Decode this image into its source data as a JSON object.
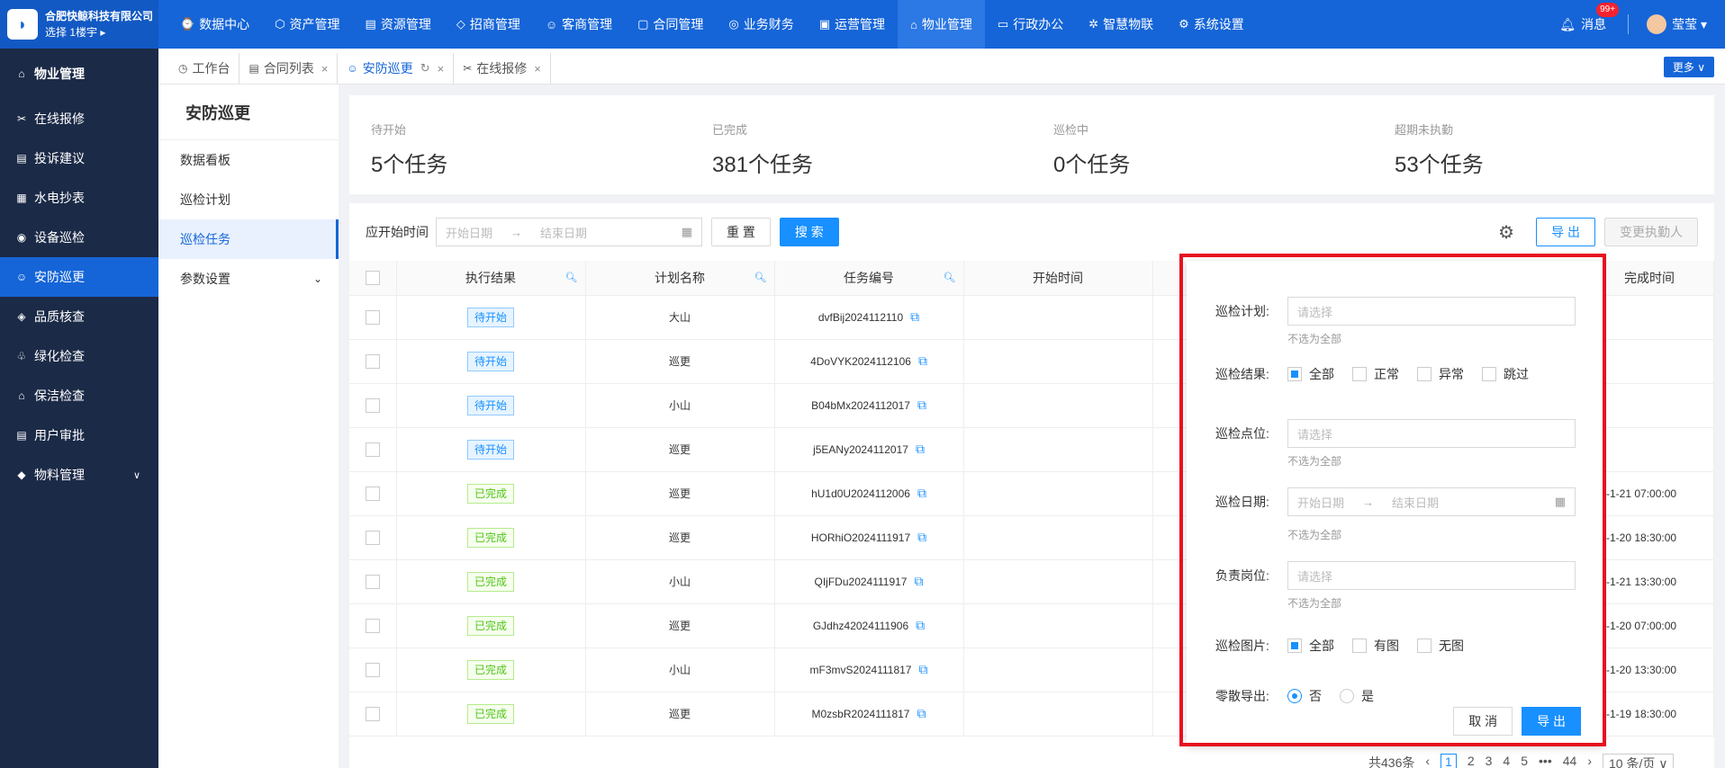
{
  "brand": {
    "name": "合肥快鲸科技有限公司",
    "sub": "选择 1楼宇 ▸"
  },
  "nav": [
    {
      "label": "数据中心",
      "icon": "⌚"
    },
    {
      "label": "资产管理",
      "icon": "⬡"
    },
    {
      "label": "资源管理",
      "icon": "▤"
    },
    {
      "label": "招商管理",
      "icon": "◇"
    },
    {
      "label": "客商管理",
      "icon": "☺"
    },
    {
      "label": "合同管理",
      "icon": "▢"
    },
    {
      "label": "业务财务",
      "icon": "◎"
    },
    {
      "label": "运营管理",
      "icon": "▣"
    },
    {
      "label": "物业管理",
      "icon": "⌂"
    },
    {
      "label": "行政办公",
      "icon": "▭"
    },
    {
      "label": "智慧物联",
      "icon": "✲"
    },
    {
      "label": "系统设置",
      "icon": "⚙"
    }
  ],
  "top_right": {
    "msg_label": "消息",
    "msg_badge": "99+",
    "user": "莹莹 ▾"
  },
  "sidebar": {
    "head": "物业管理",
    "items": [
      {
        "label": "在线报修",
        "icon": "✂"
      },
      {
        "label": "投诉建议",
        "icon": "▤"
      },
      {
        "label": "水电抄表",
        "icon": "▦"
      },
      {
        "label": "设备巡检",
        "icon": "◉"
      },
      {
        "label": "安防巡更",
        "icon": "☺"
      },
      {
        "label": "品质核查",
        "icon": "◈"
      },
      {
        "label": "绿化检查",
        "icon": "♧"
      },
      {
        "label": "保洁检查",
        "icon": "⌂"
      },
      {
        "label": "用户审批",
        "icon": "▤"
      },
      {
        "label": "物料管理",
        "icon": "◆"
      }
    ]
  },
  "tabs": [
    {
      "label": "工作台",
      "icon": "◷"
    },
    {
      "label": "合同列表",
      "icon": "▤"
    },
    {
      "label": "安防巡更",
      "icon": "☺"
    },
    {
      "label": "在线报修",
      "icon": "✂"
    }
  ],
  "more_label": "更多 ∨",
  "submenu": {
    "title": "安防巡更",
    "items": [
      "数据看板",
      "巡检计划",
      "巡检任务",
      "参数设置"
    ]
  },
  "stats": [
    {
      "label": "待开始",
      "value": "5个任务"
    },
    {
      "label": "已完成",
      "value": "381个任务"
    },
    {
      "label": "巡检中",
      "value": "0个任务"
    },
    {
      "label": "超期未执勤",
      "value": "53个任务"
    }
  ],
  "filter": {
    "label": "应开始时间",
    "start_ph": "开始日期",
    "end_ph": "结束日期",
    "reset": "重 置",
    "search": "搜 索",
    "export": "导 出",
    "change": "变更执勤人"
  },
  "table": {
    "headers": [
      "执行结果",
      "计划名称",
      "任务编号",
      "开始时间",
      "完成时间"
    ],
    "rows": [
      {
        "status": "待开始",
        "type": "pending",
        "plan": "大山",
        "code": "dvfBij2024112110",
        "end": ""
      },
      {
        "status": "待开始",
        "type": "pending",
        "plan": "巡更",
        "code": "4DoVYK2024112106",
        "end": ""
      },
      {
        "status": "待开始",
        "type": "pending",
        "plan": "小山",
        "code": "B04bMx2024112017",
        "end": ""
      },
      {
        "status": "待开始",
        "type": "pending",
        "plan": "巡更",
        "code": "j5EANy2024112017",
        "end": ""
      },
      {
        "status": "已完成",
        "type": "done",
        "plan": "巡更",
        "code": "hU1d0U2024112006",
        "end": "-1-21 07:00:00"
      },
      {
        "status": "已完成",
        "type": "done",
        "plan": "巡更",
        "code": "HORhiO2024111917",
        "end": "-1-20 18:30:00"
      },
      {
        "status": "已完成",
        "type": "done",
        "plan": "小山",
        "code": "QIjFDu2024111917",
        "end": "-1-21 13:30:00"
      },
      {
        "status": "已完成",
        "type": "done",
        "plan": "巡更",
        "code": "GJdhz42024111906",
        "end": "-1-20 07:00:00"
      },
      {
        "status": "已完成",
        "type": "done",
        "plan": "小山",
        "code": "mF3mvS2024111817",
        "end": "-1-20 13:30:00"
      },
      {
        "status": "已完成",
        "type": "done",
        "plan": "巡更",
        "code": "M0zsbR2024111817",
        "end": "-1-19 18:30:00"
      }
    ]
  },
  "popup": {
    "plan_label": "巡检计划:",
    "plan_ph": "请选择",
    "hint": "不选为全部",
    "result_label": "巡检结果:",
    "result_opts": [
      "全部",
      "正常",
      "异常",
      "跳过"
    ],
    "point_label": "巡检点位:",
    "point_ph": "请选择",
    "date_label": "巡检日期:",
    "date_start": "开始日期",
    "date_end": "结束日期",
    "post_label": "负责岗位:",
    "post_ph": "请选择",
    "img_label": "巡检图片:",
    "img_opts": [
      "全部",
      "有图",
      "无图"
    ],
    "split_label": "零散导出:",
    "split_opts": [
      "否",
      "是"
    ],
    "cancel": "取 消",
    "confirm": "导 出"
  },
  "pager": {
    "total": "共436条",
    "pages": [
      "1",
      "2",
      "3",
      "4",
      "5",
      "•••",
      "44"
    ],
    "size": "10 条/页 ∨"
  }
}
